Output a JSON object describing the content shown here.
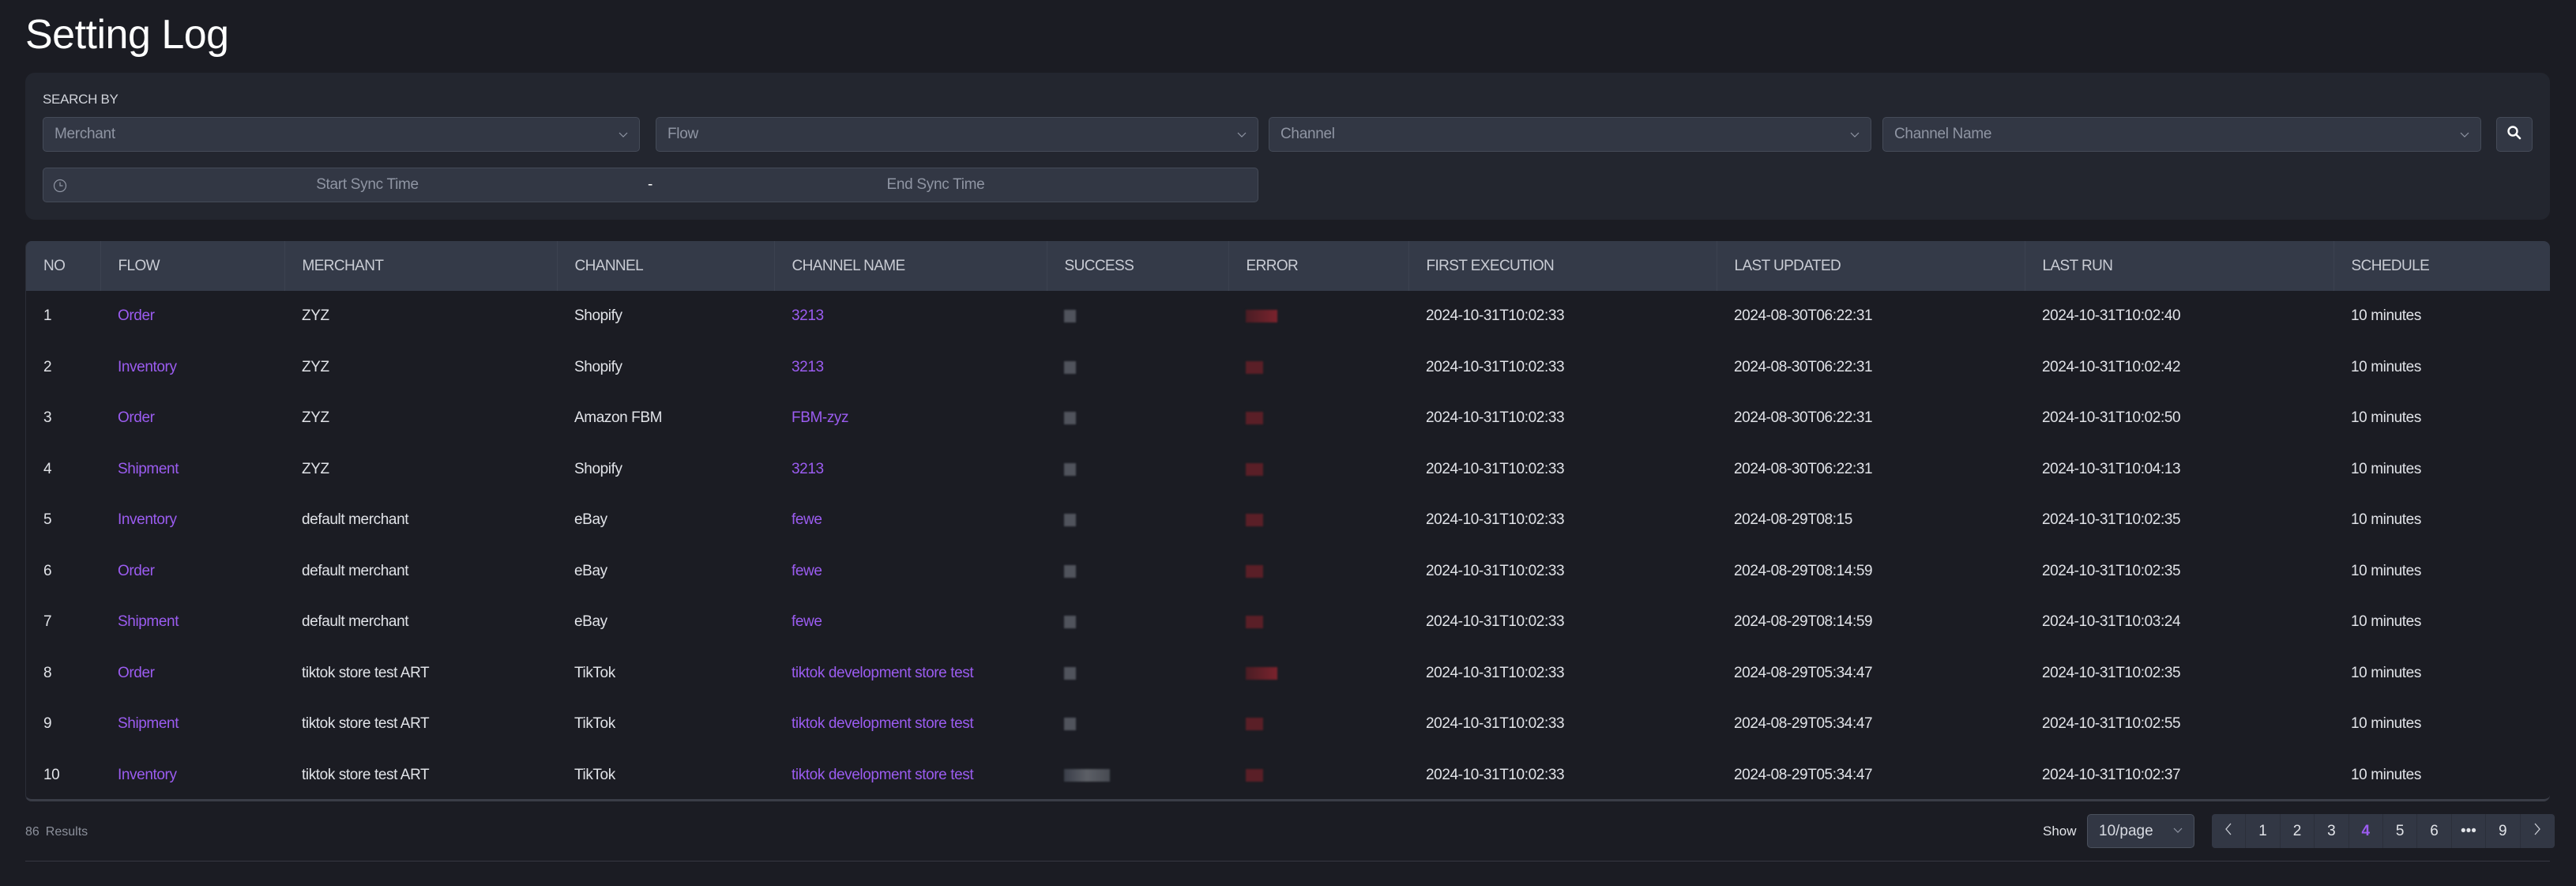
{
  "page": {
    "title": "Setting Log"
  },
  "filters": {
    "section_label": "SEARCH BY",
    "merchant_placeholder": "Merchant",
    "flow_placeholder": "Flow",
    "channel_placeholder": "Channel",
    "channel_name_placeholder": "Channel Name",
    "start_time_placeholder": "Start Sync Time",
    "range_separator": "-",
    "end_time_placeholder": "End Sync Time"
  },
  "table": {
    "columns": [
      "NO",
      "FLOW",
      "MERCHANT",
      "CHANNEL",
      "CHANNEL NAME",
      "SUCCESS",
      "ERROR",
      "FIRST EXECUTION",
      "LAST UPDATED",
      "LAST RUN",
      "SCHEDULE"
    ],
    "rows": [
      {
        "no": "1",
        "flow": "Order",
        "merchant": "ZYZ",
        "channel": "Shopify",
        "channel_name": "3213",
        "success": "[redacted]",
        "error": "[redacted]",
        "first_execution": "2024-10-31T10:02:33",
        "last_updated": "2024-08-30T06:22:31",
        "last_run": "2024-10-31T10:02:40",
        "schedule": "10 minutes"
      },
      {
        "no": "2",
        "flow": "Inventory",
        "merchant": "ZYZ",
        "channel": "Shopify",
        "channel_name": "3213",
        "success": "[redacted]",
        "error": "[redacted]",
        "first_execution": "2024-10-31T10:02:33",
        "last_updated": "2024-08-30T06:22:31",
        "last_run": "2024-10-31T10:02:42",
        "schedule": "10 minutes"
      },
      {
        "no": "3",
        "flow": "Order",
        "merchant": "ZYZ",
        "channel": "Amazon FBM",
        "channel_name": "FBM-zyz",
        "success": "[redacted]",
        "error": "[redacted]",
        "first_execution": "2024-10-31T10:02:33",
        "last_updated": "2024-08-30T06:22:31",
        "last_run": "2024-10-31T10:02:50",
        "schedule": "10 minutes"
      },
      {
        "no": "4",
        "flow": "Shipment",
        "merchant": "ZYZ",
        "channel": "Shopify",
        "channel_name": "3213",
        "success": "[redacted]",
        "error": "[redacted]",
        "first_execution": "2024-10-31T10:02:33",
        "last_updated": "2024-08-30T06:22:31",
        "last_run": "2024-10-31T10:04:13",
        "schedule": "10 minutes"
      },
      {
        "no": "5",
        "flow": "Inventory",
        "merchant": "default merchant",
        "channel": "eBay",
        "channel_name": "fewe",
        "success": "[redacted]",
        "error": "[redacted]",
        "first_execution": "2024-10-31T10:02:33",
        "last_updated": "2024-08-29T08:15",
        "last_run": "2024-10-31T10:02:35",
        "schedule": "10 minutes"
      },
      {
        "no": "6",
        "flow": "Order",
        "merchant": "default merchant",
        "channel": "eBay",
        "channel_name": "fewe",
        "success": "[redacted]",
        "error": "[redacted]",
        "first_execution": "2024-10-31T10:02:33",
        "last_updated": "2024-08-29T08:14:59",
        "last_run": "2024-10-31T10:02:35",
        "schedule": "10 minutes"
      },
      {
        "no": "7",
        "flow": "Shipment",
        "merchant": "default merchant",
        "channel": "eBay",
        "channel_name": "fewe",
        "success": "[redacted]",
        "error": "[redacted]",
        "first_execution": "2024-10-31T10:02:33",
        "last_updated": "2024-08-29T08:14:59",
        "last_run": "2024-10-31T10:03:24",
        "schedule": "10 minutes"
      },
      {
        "no": "8",
        "flow": "Order",
        "merchant": "tiktok store test ART",
        "channel": "TikTok",
        "channel_name": "tiktok development store test",
        "success": "[redacted]",
        "error": "[redacted]",
        "first_execution": "2024-10-31T10:02:33",
        "last_updated": "2024-08-29T05:34:47",
        "last_run": "2024-10-31T10:02:35",
        "schedule": "10 minutes"
      },
      {
        "no": "9",
        "flow": "Shipment",
        "merchant": "tiktok store test ART",
        "channel": "TikTok",
        "channel_name": "tiktok development store test",
        "success": "[redacted]",
        "error": "[redacted]",
        "first_execution": "2024-10-31T10:02:33",
        "last_updated": "2024-08-29T05:34:47",
        "last_run": "2024-10-31T10:02:55",
        "schedule": "10 minutes"
      },
      {
        "no": "10",
        "flow": "Inventory",
        "merchant": "tiktok store test ART",
        "channel": "TikTok",
        "channel_name": "tiktok development store test",
        "success": "[redacted]",
        "error": "[redacted]",
        "first_execution": "2024-10-31T10:02:33",
        "last_updated": "2024-08-29T05:34:47",
        "last_run": "2024-10-31T10:02:37",
        "schedule": "10 minutes"
      }
    ]
  },
  "footer": {
    "result_count": "86",
    "result_label": "Results",
    "show_label": "Show",
    "page_size": "10/page",
    "pages": [
      "1",
      "2",
      "3",
      "4",
      "5",
      "6",
      "•••",
      "9"
    ],
    "current_page": "4",
    "prev_icon": "chevron-left-icon",
    "next_icon": "chevron-right-icon"
  },
  "colors": {
    "accent": "#9b5cf0",
    "background": "#1b1c23",
    "panel": "#23262f",
    "table_header": "#343a48",
    "input": "#323744"
  }
}
